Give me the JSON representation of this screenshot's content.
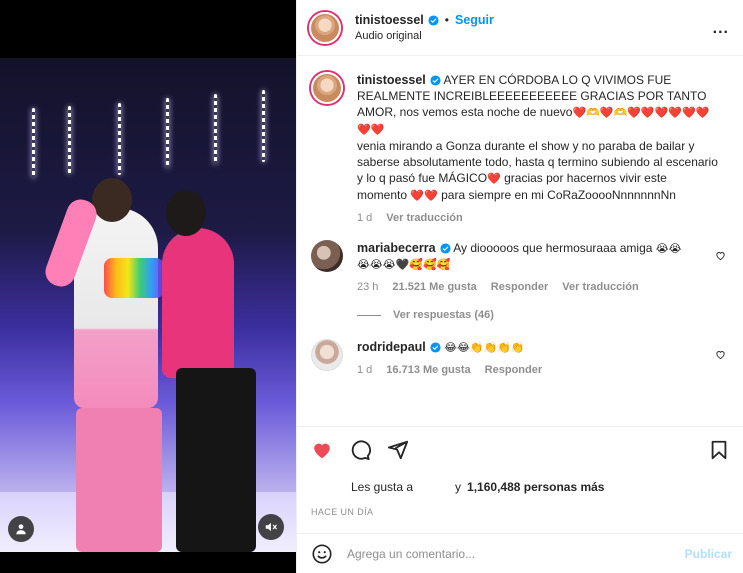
{
  "post": {
    "username": "tinistoessel",
    "follow_label": "Seguir",
    "separator": "•",
    "audio_label": "Audio original",
    "more_label": "..."
  },
  "caption": {
    "username": "tinistoessel",
    "text_1": "AYER EN CÓRDOBA LO Q VIVIMOS FUE REALMENTE INCREIBLEEEEEEEEEEE GRACIAS POR TANTO AMOR, nos vemos esta noche de nuevo",
    "hearts_1": "❤️🫶❤️🫶❤️❤️❤️❤️❤️❤️❤️❤️",
    "text_2": "venia mirando a Gonza durante el show y no paraba de bailar y saberse absolutamente todo, hasta q termino subiendo al escenario y lo q pasó fue MÁGICO",
    "heart_2": "❤️",
    "text_3": "gracias por hacernos vivir este momento",
    "hearts_3": "❤️❤️",
    "text_4": "para siempre en mi CoRaZooooNnnnnnnNn",
    "time": "1 d",
    "translate": "Ver traducción"
  },
  "comments": [
    {
      "username": "mariabecerra",
      "text": "Ay diooooos que hermosuraaa amiga",
      "emoji_1": "😭😭",
      "emoji_2": "😭😭😭🖤🥰🥰🥰",
      "time": "23 h",
      "likes": "21.521 Me gusta",
      "reply": "Responder",
      "translate": "Ver traducción",
      "view_replies": "Ver respuestas (46)"
    },
    {
      "username": "rodridepaul",
      "emoji": "😂😂👏👏👏👏",
      "time": "1 d",
      "likes": "16.713 Me gusta",
      "reply": "Responder"
    }
  ],
  "likes": {
    "prefix": "Les gusta a",
    "connector": "y",
    "count": "1,160,488 personas más"
  },
  "timestamp": "HACE UN DÍA",
  "add_comment": {
    "placeholder": "Agrega un comentario...",
    "publish_label": "Publicar"
  },
  "colors": {
    "like_red": "#ed4956",
    "link_blue": "#0095f6",
    "verified_blue": "#0095f6",
    "muted_gray": "#8e8e8e"
  }
}
